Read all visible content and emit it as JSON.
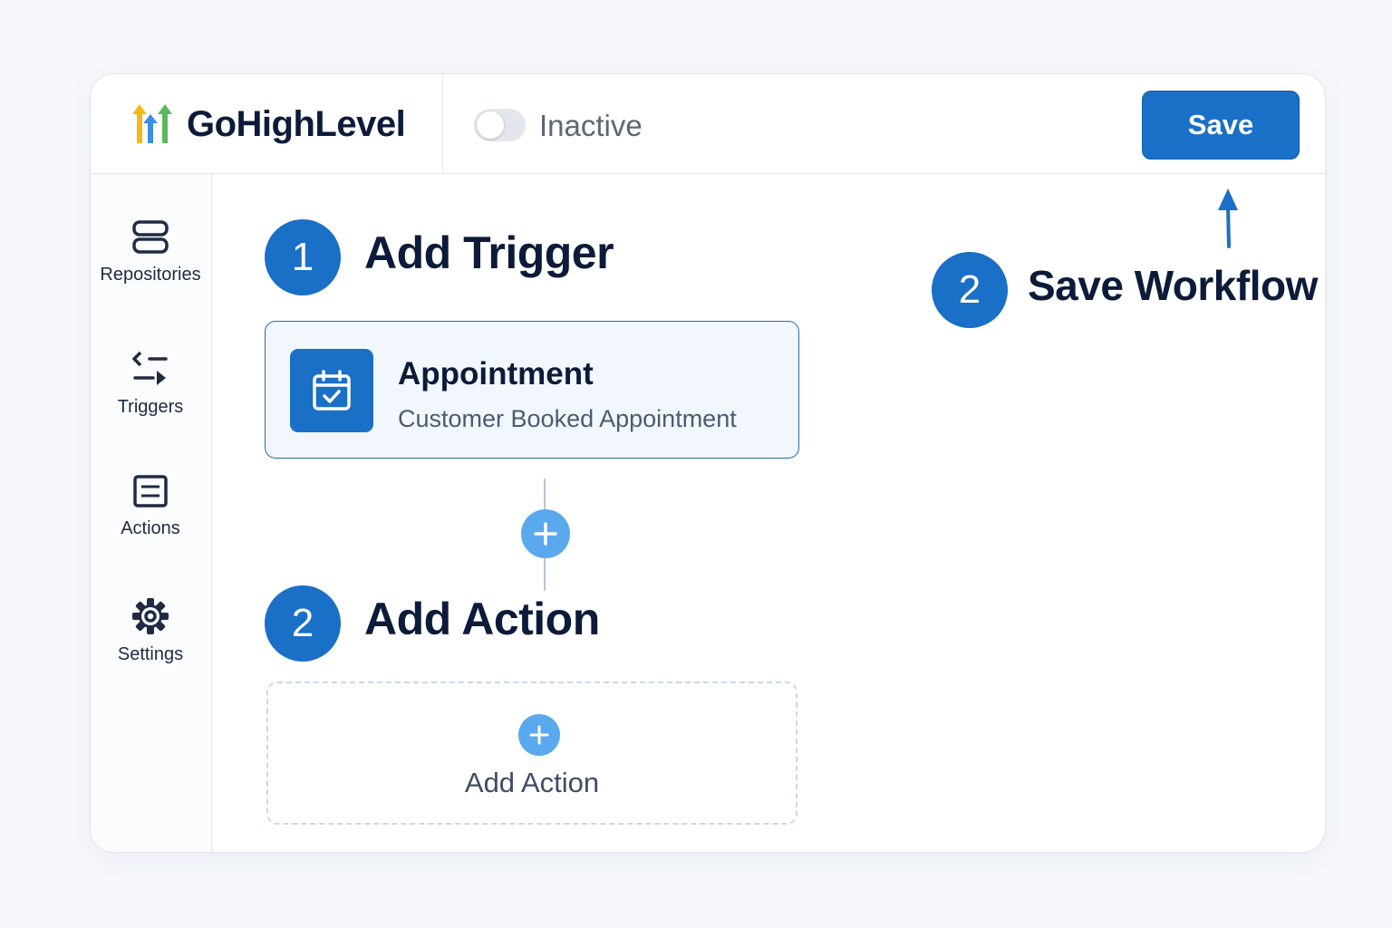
{
  "brand": {
    "name": "GoHighLevel",
    "logo_icon": "three-arrows-logo-icon"
  },
  "header": {
    "status_label": "Inactive",
    "toggle_state": "off",
    "save_label": "Save"
  },
  "sidebar": {
    "items": [
      {
        "label": "Repositories",
        "icon": "stack-icon"
      },
      {
        "label": "Triggers",
        "icon": "trigger-arrows-icon"
      },
      {
        "label": "Actions",
        "icon": "list-box-icon"
      },
      {
        "label": "Settings",
        "icon": "gear-icon"
      }
    ]
  },
  "steps": {
    "trigger": {
      "number": "1",
      "title": "Add Trigger"
    },
    "action": {
      "number": "2",
      "title": "Add Action"
    },
    "save": {
      "number": "2",
      "title": "Save Workflow"
    }
  },
  "trigger_card": {
    "title": "Appointment",
    "subtitle": "Customer Booked Appointment",
    "icon": "calendar-check-icon"
  },
  "add_action_box": {
    "label": "Add Action",
    "icon": "plus-icon"
  },
  "colors": {
    "accent": "#1a6fc6",
    "light_accent": "#5aa8ee",
    "text": "#0d1b3a",
    "muted": "#5c6678",
    "logo_yellow": "#f5b814",
    "logo_blue": "#3a8ee6",
    "logo_green": "#5cb85c"
  }
}
